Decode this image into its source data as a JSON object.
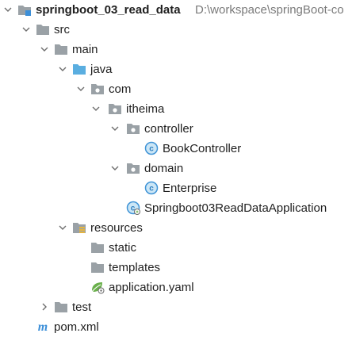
{
  "project": {
    "name": "springboot_03_read_data",
    "path": "D:\\workspace\\springBoot-co"
  },
  "tree": {
    "src": "src",
    "main": "main",
    "java": "java",
    "com": "com",
    "itheima": "itheima",
    "controller": "controller",
    "book_controller": "BookController",
    "domain": "domain",
    "enterprise": "Enterprise",
    "application_class": "Springboot03ReadDataApplication",
    "resources": "resources",
    "static": "static",
    "templates": "templates",
    "application_yaml": "application.yaml",
    "test": "test",
    "pom": "pom.xml"
  },
  "icon_letters": {
    "class": "c",
    "maven": "m"
  },
  "colors": {
    "folder_gray": "#9aa1a6",
    "source_folder_blue": "#5aaee0",
    "class_circle": "#3f93d6",
    "class_circle_fill": "#cbe6f6",
    "spring_green": "#6ab04c",
    "maven_blue": "#3c8fd8",
    "arrow": "#6e6e6e",
    "path_text": "#7a7a7a"
  }
}
